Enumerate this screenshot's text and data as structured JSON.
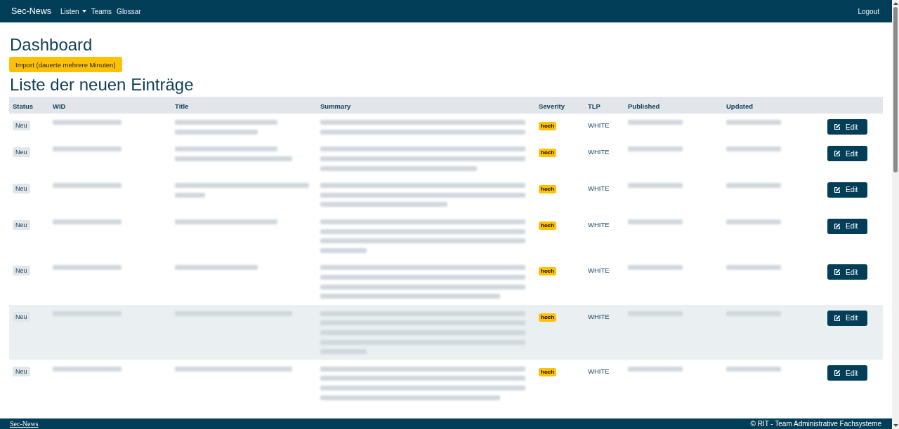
{
  "navbar": {
    "brand": "Sec-News",
    "links": [
      {
        "label": "Listen",
        "kind": "dropdown"
      },
      {
        "label": "Teams",
        "kind": "link"
      },
      {
        "label": "Glossar",
        "kind": "link"
      }
    ],
    "logout": "Logout"
  },
  "page": {
    "title": "Dashboard",
    "import_button": "Import (dauerte mehrere Minuten)",
    "list_title": "Liste der neuen Einträge"
  },
  "table": {
    "columns": [
      "Status",
      "WID",
      "Title",
      "Summary",
      "Severity",
      "TLP",
      "Published",
      "Updated"
    ],
    "rows": [
      {
        "highlighted": false,
        "status": "Neu",
        "wid": {
          "blurred_lines": [
            {
              "kind": "half"
            }
          ]
        },
        "title": {
          "blurred_lines": [
            {
              "kind": "medium"
            },
            {
              "kind": "half"
            }
          ]
        },
        "summary": {
          "blurred_lines": [
            {
              "kind": "full"
            },
            {
              "kind": "full"
            }
          ]
        },
        "severity": "hoch",
        "tlp": "WHITE",
        "published": {
          "blurred_lines": [
            {
              "kind": "half"
            }
          ]
        },
        "updated": {
          "blurred_lines": [
            {
              "kind": "half"
            }
          ]
        },
        "action": "Edit"
      },
      {
        "highlighted": false,
        "status": "Neu",
        "wid": {
          "blurred_lines": [
            {
              "kind": "half"
            }
          ]
        },
        "title": {
          "blurred_lines": [
            {
              "kind": "medium"
            },
            {
              "kind": "long"
            }
          ]
        },
        "summary": {
          "blurred_lines": [
            {
              "kind": "full"
            },
            {
              "kind": "full"
            },
            {
              "kind": "medium"
            }
          ]
        },
        "severity": "hoch",
        "tlp": "WHITE",
        "published": {
          "blurred_lines": [
            {
              "kind": "half"
            }
          ]
        },
        "updated": {
          "blurred_lines": [
            {
              "kind": "half"
            }
          ]
        },
        "action": "Edit"
      },
      {
        "highlighted": false,
        "status": "Neu",
        "wid": {
          "blurred_lines": [
            {
              "kind": "half"
            }
          ]
        },
        "title": {
          "blurred_lines": [
            {
              "kind": "full"
            },
            {
              "kind": "short"
            }
          ]
        },
        "summary": {
          "blurred_lines": [
            {
              "kind": "full"
            },
            {
              "kind": "full"
            },
            {
              "kind": "half"
            }
          ]
        },
        "severity": "hoch",
        "tlp": "WHITE",
        "published": {
          "blurred_lines": [
            {
              "kind": "half"
            }
          ]
        },
        "updated": {
          "blurred_lines": [
            {
              "kind": "half"
            }
          ]
        },
        "action": "Edit"
      },
      {
        "highlighted": false,
        "status": "Neu",
        "wid": {
          "blurred_lines": [
            {
              "kind": "half"
            }
          ]
        },
        "title": {
          "blurred_lines": [
            {
              "kind": "medium"
            }
          ]
        },
        "summary": {
          "blurred_lines": [
            {
              "kind": "full"
            },
            {
              "kind": "full"
            },
            {
              "kind": "full"
            },
            {
              "kind": "short"
            }
          ]
        },
        "severity": "hoch",
        "tlp": "WHITE",
        "published": {
          "blurred_lines": [
            {
              "kind": "half"
            }
          ]
        },
        "updated": {
          "blurred_lines": [
            {
              "kind": "half"
            }
          ]
        },
        "action": "Edit"
      },
      {
        "highlighted": false,
        "status": "Neu",
        "wid": {
          "blurred_lines": [
            {
              "kind": "half"
            }
          ]
        },
        "title": {
          "blurred_lines": [
            {
              "kind": "half"
            }
          ]
        },
        "summary": {
          "blurred_lines": [
            {
              "kind": "full"
            },
            {
              "kind": "full"
            },
            {
              "kind": "full"
            },
            {
              "kind": "long"
            }
          ]
        },
        "severity": "hoch",
        "tlp": "WHITE",
        "published": {
          "blurred_lines": [
            {
              "kind": "half"
            }
          ]
        },
        "updated": {
          "blurred_lines": [
            {
              "kind": "half"
            }
          ]
        },
        "action": "Edit"
      },
      {
        "highlighted": true,
        "status": "Neu",
        "wid": {
          "blurred_lines": [
            {
              "kind": "half"
            }
          ]
        },
        "title": {
          "blurred_lines": [
            {
              "kind": "long"
            }
          ]
        },
        "summary": {
          "blurred_lines": [
            {
              "kind": "full"
            },
            {
              "kind": "full"
            },
            {
              "kind": "full"
            },
            {
              "kind": "full"
            },
            {
              "kind": "short"
            }
          ]
        },
        "severity": "hoch",
        "tlp": "WHITE",
        "published": {
          "blurred_lines": [
            {
              "kind": "half"
            }
          ]
        },
        "updated": {
          "blurred_lines": [
            {
              "kind": "half"
            }
          ]
        },
        "action": "Edit"
      },
      {
        "highlighted": false,
        "status": "Neu",
        "wid": {
          "blurred_lines": [
            {
              "kind": "half"
            }
          ]
        },
        "title": {
          "blurred_lines": [
            {
              "kind": "long"
            }
          ]
        },
        "summary": {
          "blurred_lines": [
            {
              "kind": "full"
            },
            {
              "kind": "full"
            },
            {
              "kind": "full"
            },
            {
              "kind": "long"
            }
          ]
        },
        "severity": "hoch",
        "tlp": "WHITE",
        "published": {
          "blurred_lines": [
            {
              "kind": "half"
            }
          ]
        },
        "updated": {
          "blurred_lines": [
            {
              "kind": "half"
            }
          ]
        },
        "action": "Edit"
      }
    ]
  },
  "footer": {
    "link": "Sec-News",
    "copyright": "© RIT - Team Administrative Fachsysteme"
  }
}
